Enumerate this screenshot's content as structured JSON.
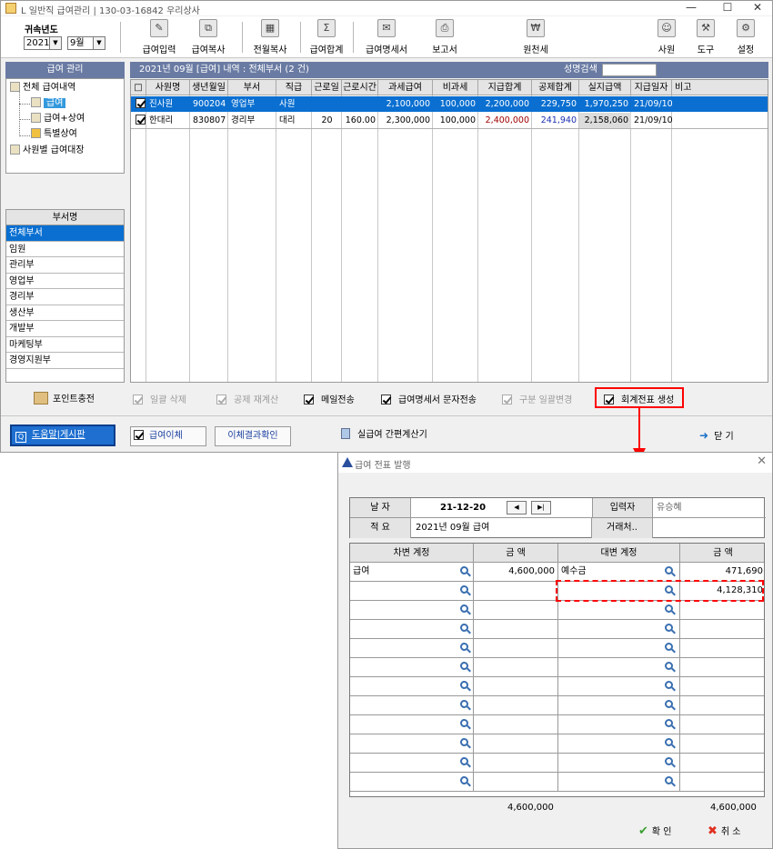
{
  "window": {
    "title": "L 일반직 급여관리 | 130-03-16842  우리상사"
  },
  "toolbar": {
    "year_label": "귀속년도",
    "year_value": "2021",
    "month_value": "9월",
    "buttons": [
      {
        "label": "급여입력",
        "icon": "edit-icon"
      },
      {
        "label": "급여복사",
        "icon": "copy-icon"
      },
      {
        "label": "전월복사",
        "icon": "calendar-icon"
      },
      {
        "label": "급여합계",
        "icon": "sum-icon"
      },
      {
        "label": "급여명세서",
        "icon": "mail-icon"
      },
      {
        "label": "보고서",
        "icon": "printer-icon"
      },
      {
        "label": "원천세",
        "icon": "tax-icon"
      },
      {
        "label": "사원",
        "icon": "user-icon"
      },
      {
        "label": "도구",
        "icon": "tools-icon"
      },
      {
        "label": "설정",
        "icon": "settings-icon"
      }
    ]
  },
  "left": {
    "section_title": "급여 관리",
    "tree": [
      {
        "label": "전체 급여내역",
        "selected": false
      },
      {
        "label": "급여",
        "selected": true
      },
      {
        "label": "급여+상여",
        "selected": false
      },
      {
        "label": "특별상여",
        "selected": false
      },
      {
        "label": "사원별 급여대장",
        "selected": false
      }
    ],
    "dept_header": "부서명",
    "depts": [
      "전체부서",
      "임원",
      "관리부",
      "영업부",
      "경리부",
      "생산부",
      "개발부",
      "마케팅부",
      "경영지원부"
    ]
  },
  "grid": {
    "title": "2021년 09월 [급여] 내역 : 전체부서 (2 건)",
    "search_label": "성명검색",
    "columns": [
      "□",
      "사원명",
      "생년월일",
      "부서",
      "직급",
      "근로일",
      "근로시간",
      "과세급여",
      "비과세",
      "지급합계",
      "공제합계",
      "실지급액",
      "지급일자",
      "비고"
    ],
    "rows": [
      {
        "checked": true,
        "name": "진사원",
        "birth": "900204",
        "dept": "영업부",
        "rank": "사원",
        "workdays": "",
        "workhours": "",
        "taxable": "2,100,000",
        "nontax": "100,000",
        "total_pay": "2,200,000",
        "deduct": "229,750",
        "net": "1,970,250",
        "paydate": "21/09/10",
        "memo": ""
      },
      {
        "checked": true,
        "name": "한대리",
        "birth": "830807",
        "dept": "경리부",
        "rank": "대리",
        "workdays": "20",
        "workhours": "160.00",
        "taxable": "2,300,000",
        "nontax": "100,000",
        "total_pay": "2,400,000",
        "deduct": "241,940",
        "net": "2,158,060",
        "paydate": "21/09/10",
        "memo": ""
      }
    ]
  },
  "options": {
    "point_charge": "포인트충전",
    "bulk_delete": "일괄 삭제",
    "recalc_deduct": "공제 재계산",
    "email_send": "메일전송",
    "sms_send": "급여명세서 문자전송",
    "bulk_change": "구분 일괄변경",
    "voucher_create": "회계전표 생성"
  },
  "bottom": {
    "help": "도움말|게시판",
    "transfer": "급여이체",
    "transfer_check": "이체결과확인",
    "calc": "실급여 간편계산기",
    "close": "닫 기"
  },
  "dialog": {
    "title": "급여 전표 발행",
    "date_label": "날  자",
    "date_value": "21-12-20",
    "inputter_label": "입력자",
    "inputter_value": "유승혜",
    "summary_label": "적  요",
    "summary_value": "2021년 09월 급여",
    "partner_label": "거래처..",
    "debit_header": "차변 계정",
    "amount_header": "금  액",
    "credit_header": "대변 계정",
    "lines": [
      {
        "debit_account": "급여",
        "debit_amount": "4,600,000",
        "credit_account": "예수금",
        "credit_amount": "471,690"
      },
      {
        "debit_account": "",
        "debit_amount": "",
        "credit_account": "",
        "credit_amount": "4,128,310"
      }
    ],
    "empty_rows": 10,
    "debit_total": "4,600,000",
    "credit_total": "4,600,000",
    "ok": "확 인",
    "cancel": "취 소"
  }
}
